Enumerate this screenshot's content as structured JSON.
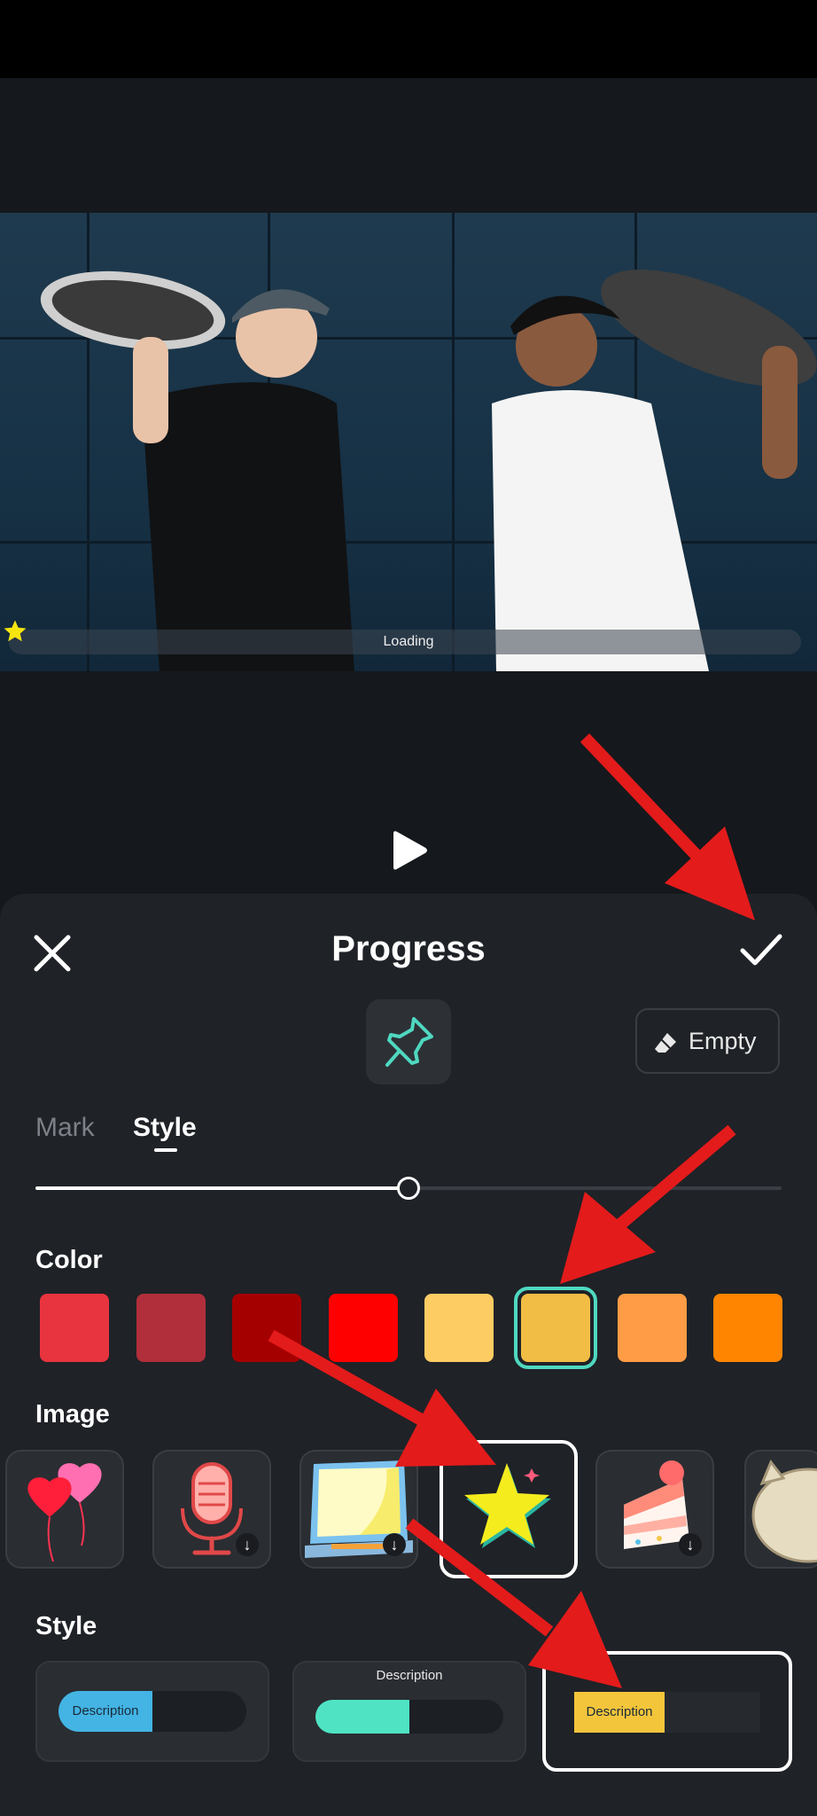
{
  "status_bar": {},
  "preview": {
    "overlay_text": "Loading",
    "overlay_progress": 0.0
  },
  "panel": {
    "title": "Progress",
    "empty_label": "Empty",
    "tabs": [
      {
        "label": "Mark",
        "active": false
      },
      {
        "label": "Style",
        "active": true
      }
    ],
    "slider_value": 0.5,
    "color_section_label": "Color",
    "colors": [
      "#e8343f",
      "#b02f3a",
      "#a50000",
      "#ff0000",
      "#fdcc63",
      "#f2bd45",
      "#ff9c45",
      "#ff8500"
    ],
    "selected_color_index": 5,
    "accent_color": "#4fd8c0",
    "image_section_label": "Image",
    "images": [
      {
        "icon": "heart-balloons-icon",
        "downloadable": false
      },
      {
        "icon": "microphone-icon",
        "downloadable": true
      },
      {
        "icon": "laptop-icon",
        "downloadable": true
      },
      {
        "icon": "star-icon",
        "downloadable": false,
        "selected": true
      },
      {
        "icon": "cake-slice-icon",
        "downloadable": true
      },
      {
        "icon": "cat-icon",
        "downloadable": false
      }
    ],
    "style_section_label": "Style",
    "styles": [
      {
        "label": "Description",
        "fill_color": "#43b4e4",
        "selected": false
      },
      {
        "label": "Description",
        "fill_color": "#4fe3c4",
        "selected": false
      },
      {
        "label": "Description",
        "fill_color": "#f3c53b",
        "selected": true
      }
    ]
  },
  "annotation_color": "#e31b1b"
}
